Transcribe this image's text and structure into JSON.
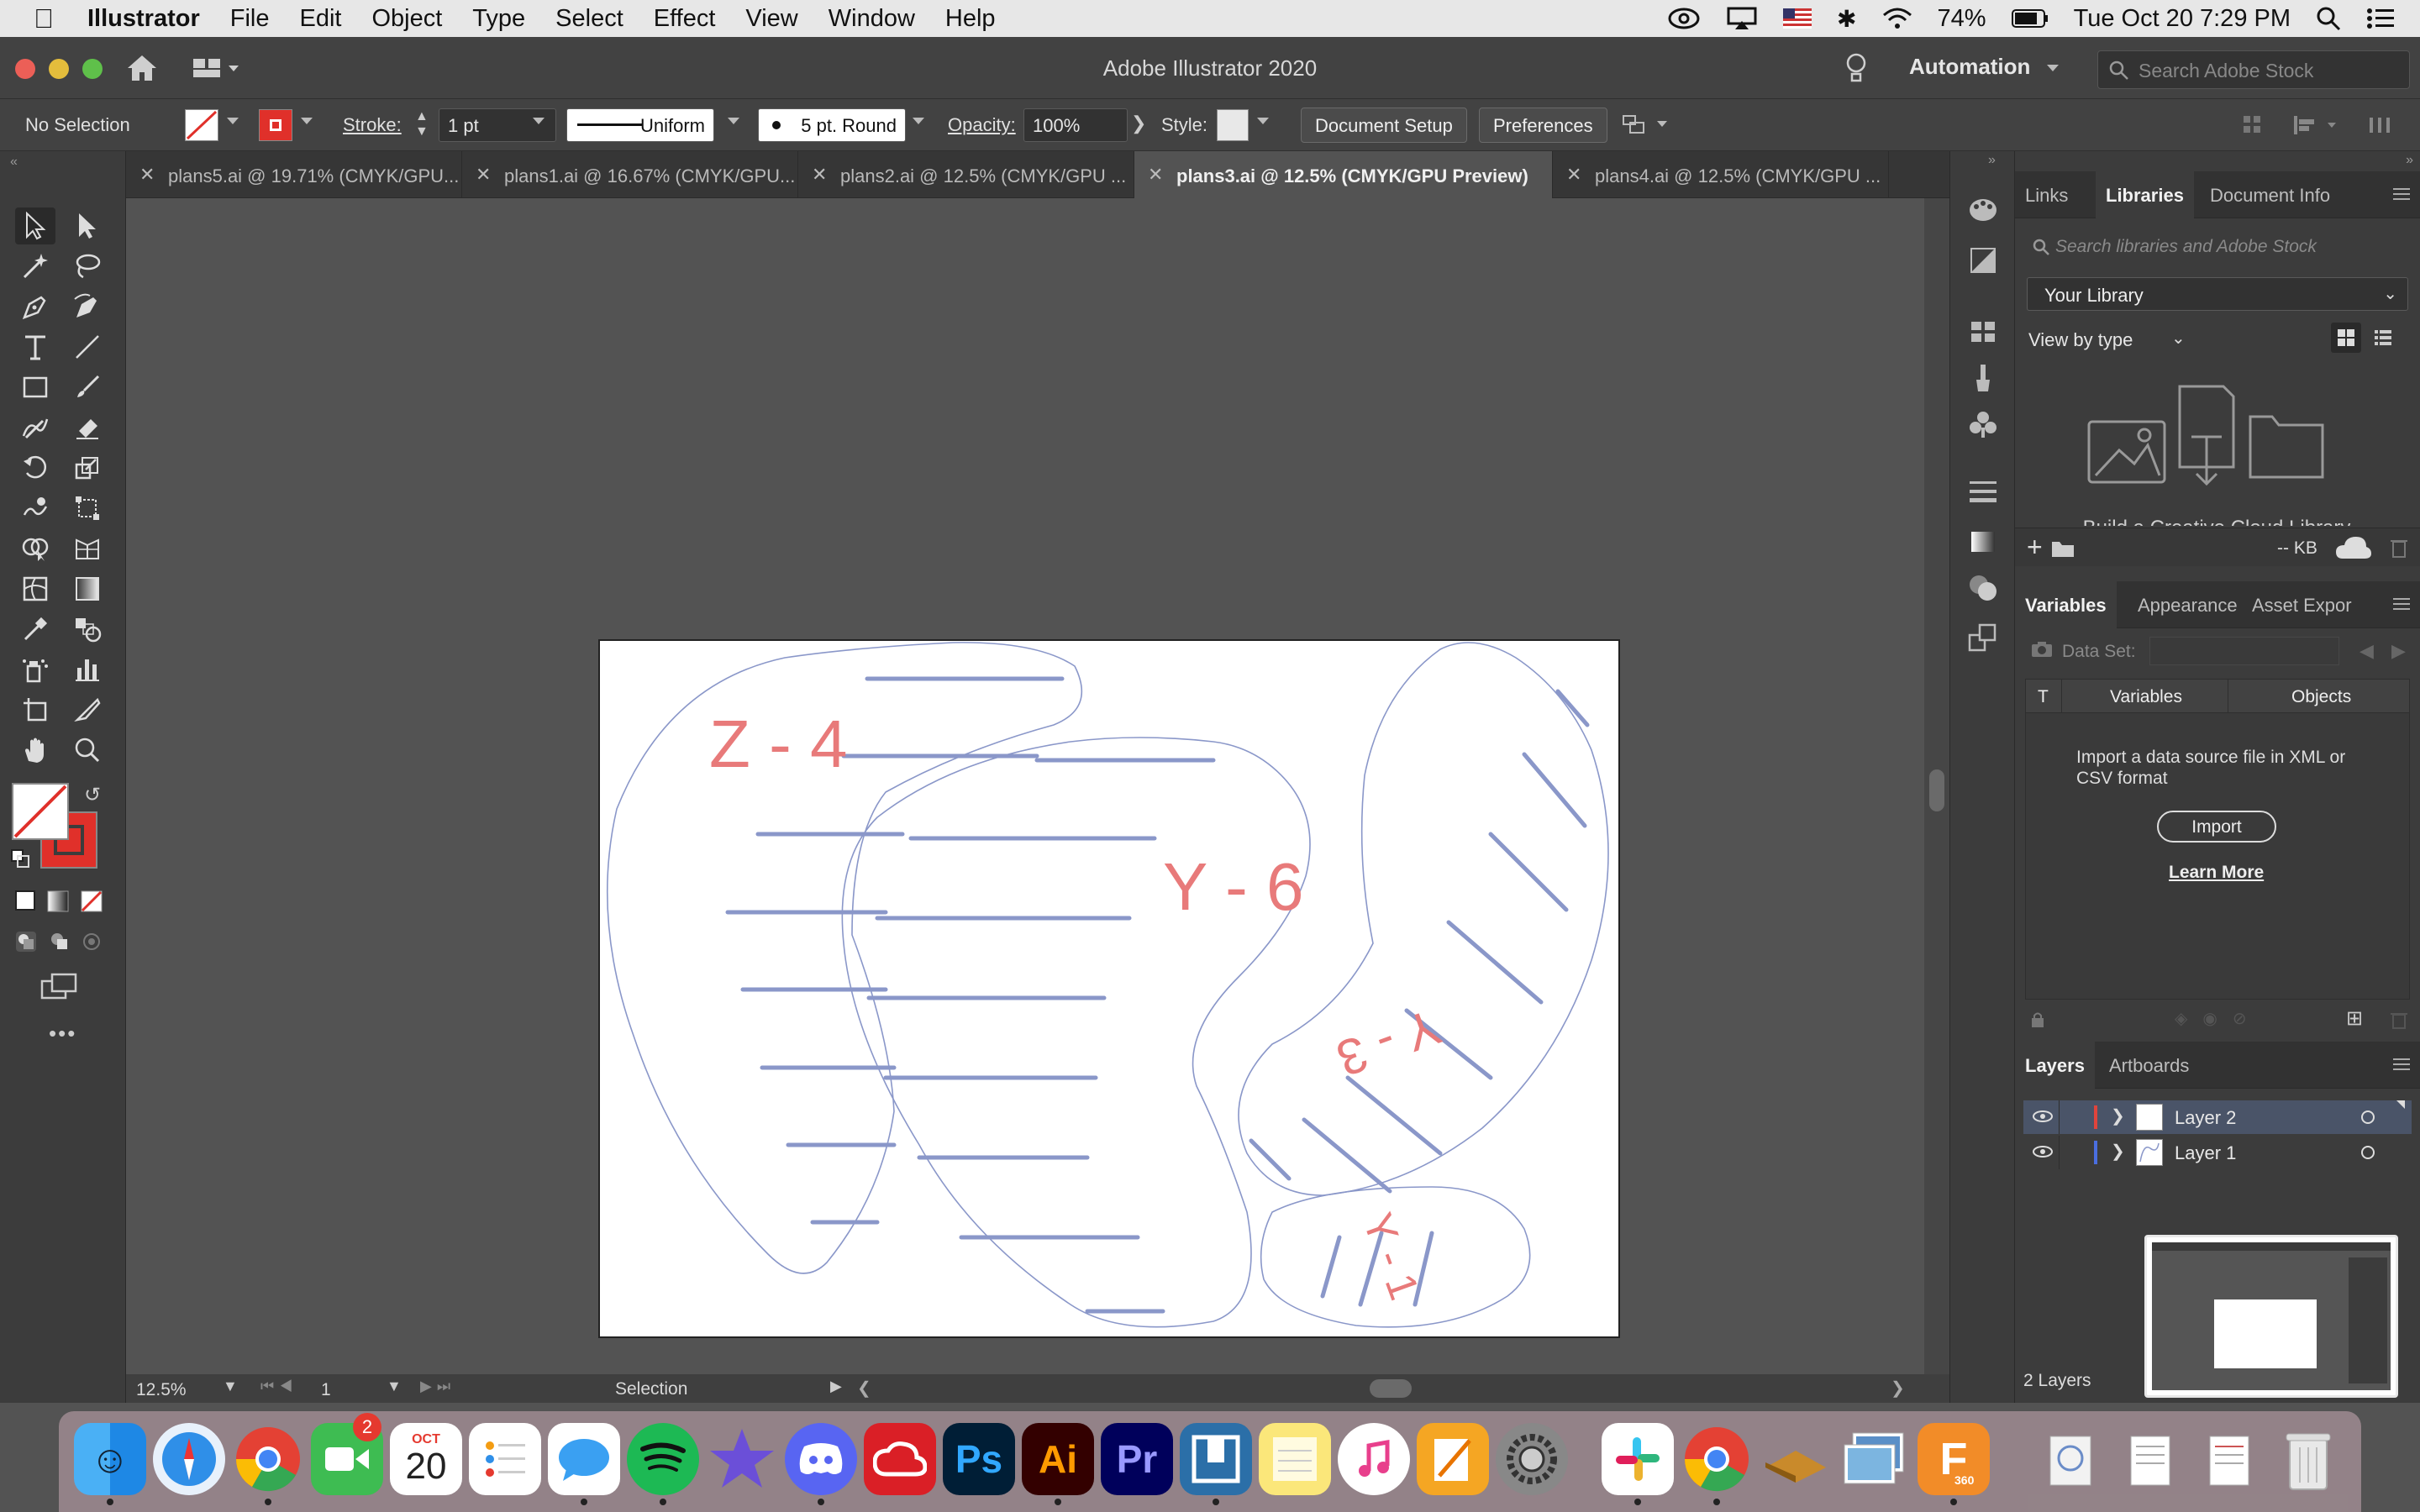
{
  "menubar": {
    "app_name": "Illustrator",
    "items": [
      "File",
      "Edit",
      "Object",
      "Type",
      "Select",
      "Effect",
      "View",
      "Window",
      "Help"
    ],
    "battery": "74%",
    "datetime": "Tue Oct 20  7:29 PM"
  },
  "titlebar": {
    "title": "Adobe Illustrator 2020",
    "workspace": "Automation",
    "search_placeholder": "Search Adobe Stock"
  },
  "controlbar": {
    "selection": "No Selection",
    "stroke_label": "Stroke:",
    "stroke_weight": "1 pt",
    "profile": "Uniform",
    "brush": "5 pt. Round",
    "opacity_label": "Opacity:",
    "opacity": "100%",
    "style_label": "Style:",
    "document_setup": "Document Setup",
    "preferences": "Preferences"
  },
  "tabs": [
    "plans5.ai @ 19.71% (CMYK/GPU...",
    "plans1.ai @ 16.67% (CMYK/GPU...",
    "plans2.ai @ 12.5% (CMYK/GPU ...",
    "plans3.ai @ 12.5% (CMYK/GPU Preview)",
    "plans4.ai @ 12.5% (CMYK/GPU ..."
  ],
  "artwork_labels": {
    "z4": "Z - 4",
    "y6": "Y - 6",
    "y3": "Y - 3",
    "y1": "Y - 1"
  },
  "statusbar": {
    "zoom": "12.5%",
    "artboard": "1",
    "tool": "Selection"
  },
  "libraries_panel": {
    "tabs": [
      "Links",
      "Libraries",
      "Document Info"
    ],
    "search_placeholder": "Search libraries and Adobe Stock",
    "library": "Your Library",
    "view_by": "View by type",
    "size": "-- KB",
    "partial_text": "Build a Creative Cloud Library"
  },
  "variables_panel": {
    "tabs": [
      "Variables",
      "Appearance",
      "Asset Expor"
    ],
    "data_set_label": "Data Set:",
    "col_type": "T",
    "col_variables": "Variables",
    "col_objects": "Objects",
    "message": "Import a data source file in XML or CSV format",
    "import": "Import",
    "learn_more": "Learn More"
  },
  "layers_panel": {
    "tabs": [
      "Layers",
      "Artboards"
    ],
    "layers": [
      {
        "name": "Layer 2",
        "color": "#e0443c"
      },
      {
        "name": "Layer 1",
        "color": "#4a6ee0"
      }
    ],
    "count": "2 Layers"
  },
  "dock": {
    "calendar_month": "OCT",
    "calendar_day": "20",
    "facetime_badge": "2",
    "fusion_label": "360",
    "apps": [
      "Finder",
      "Safari",
      "Chrome",
      "FaceTime",
      "Calendar",
      "Reminders",
      "Messages",
      "Spotify",
      "iMovie",
      "Discord",
      "Creative Cloud",
      "Ps",
      "Ai",
      "Pr",
      "Mirror",
      "Notes",
      "iTunes",
      "Pages",
      "System Preferences",
      "Slack",
      "Chrome",
      "Drive",
      "Preview",
      "Fusion 360",
      "Files",
      "Docs",
      "Docs",
      "Trash"
    ]
  }
}
